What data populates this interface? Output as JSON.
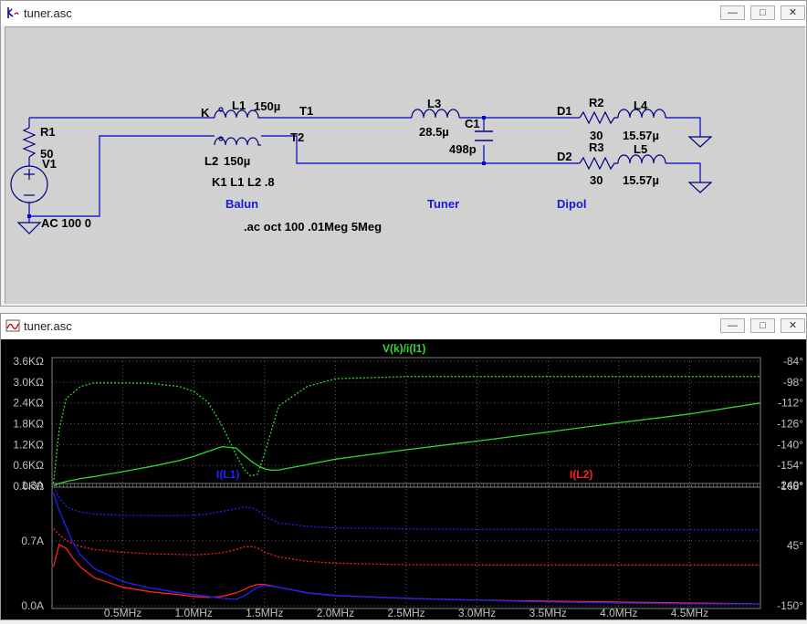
{
  "schematic_window": {
    "title": "tuner.asc",
    "buttons": {
      "minimize": "—",
      "maximize": "□",
      "close": "✕"
    },
    "components": {
      "r1_name": "R1",
      "r1_value": "50",
      "v1_name": "V1",
      "v1_value": "AC 100 0",
      "node_k": "K",
      "l1_name": "L1",
      "l1_value": "150µ",
      "l2_name": "L2",
      "l2_value": "150µ",
      "coupling": "K1 L1 L2 .8",
      "node_t1": "T1",
      "node_t2": "T2",
      "l3_name": "L3",
      "l3_value": "28.5µ",
      "c1_name": "C1",
      "c1_value": "498p",
      "node_d1": "D1",
      "node_d2": "D2",
      "r2_name": "R2",
      "r2_value": "30",
      "r3_name": "R3",
      "r3_value": "30",
      "l4_name": "L4",
      "l4_value": "15.57µ",
      "l5_name": "L5",
      "l5_value": "15.57µ"
    },
    "labels": {
      "balun": "Balun",
      "tuner": "Tuner",
      "dipol": "Dipol"
    },
    "directive": ".ac oct 100 .01Meg 5Meg",
    "colors": {
      "wire": "#0000c8",
      "component": "#000080",
      "label_blue": "#1a1ad0",
      "background": "#d1d1d1"
    }
  },
  "plot_window": {
    "title": "tuner.asc",
    "buttons": {
      "minimize": "—",
      "maximize": "□",
      "close": "✕"
    }
  },
  "chart_data": [
    {
      "type": "line",
      "trace_label": "V(k)/i(l1)",
      "trace_color": "#2ed82e",
      "y_left_ticks": [
        "3.6KΩ",
        "3.0KΩ",
        "2.4KΩ",
        "1.8KΩ",
        "1.2KΩ",
        "0.6KΩ",
        "0.0KΩ"
      ],
      "y_right_ticks": [
        "-84°",
        "-98°",
        "-112°",
        "-126°",
        "-140°",
        "-154°",
        "-168°"
      ],
      "x": [
        0.01,
        0.05,
        0.1,
        0.2,
        0.3,
        0.5,
        0.7,
        0.9,
        1.0,
        1.1,
        1.2,
        1.3,
        1.35,
        1.4,
        1.45,
        1.5,
        1.55,
        1.6,
        1.8,
        2.0,
        2.5,
        3.0,
        3.5,
        4.0,
        4.5,
        5.0
      ],
      "series": [
        {
          "name": "magnitude",
          "values": [
            0.02,
            0.08,
            0.14,
            0.22,
            0.28,
            0.42,
            0.57,
            0.74,
            0.86,
            1.0,
            1.14,
            1.1,
            0.91,
            0.74,
            0.6,
            0.5,
            0.46,
            0.47,
            0.62,
            0.78,
            1.05,
            1.3,
            1.56,
            1.83,
            2.08,
            2.4
          ]
        },
        {
          "name": "phase",
          "values": [
            -166,
            -130,
            -109,
            -101,
            -98.6,
            -98.6,
            -98.9,
            -101,
            -104.3,
            -111.4,
            -127.1,
            -147.1,
            -156,
            -161,
            -160,
            -146,
            -130,
            -114,
            -101,
            -95.7,
            -94.3,
            -94.3,
            -94.3,
            -94.3,
            -94.3,
            -94.3
          ]
        }
      ],
      "ylim": [
        0,
        3.6
      ],
      "y2lim": [
        -168,
        -84
      ],
      "xlim": [
        0,
        5
      ]
    },
    {
      "type": "line",
      "trace_labels": [
        "I(L1)",
        "I(L2)"
      ],
      "trace_colors": [
        "#2020ff",
        "#ff2020"
      ],
      "y_left_ticks": [
        "1.3A",
        "0.7A",
        "0.0A"
      ],
      "y_right_ticks": [
        "240°",
        "45°",
        "-150°"
      ],
      "x_ticks": [
        "0.5MHz",
        "1.0MHz",
        "1.5MHz",
        "2.0MHz",
        "2.5MHz",
        "3.0MHz",
        "3.5MHz",
        "4.0MHz",
        "4.5MHz"
      ],
      "x": [
        0.01,
        0.05,
        0.1,
        0.15,
        0.2,
        0.3,
        0.5,
        0.7,
        0.9,
        1.0,
        1.1,
        1.2,
        1.3,
        1.35,
        1.4,
        1.45,
        1.5,
        1.6,
        1.8,
        2.0,
        2.5,
        3.0,
        3.5,
        4.0,
        4.5,
        5.0
      ],
      "series": [
        {
          "name": "I(L1)",
          "values": [
            1.22,
            1.03,
            0.85,
            0.68,
            0.55,
            0.4,
            0.26,
            0.19,
            0.14,
            0.12,
            0.1,
            0.08,
            0.07,
            0.1,
            0.15,
            0.2,
            0.22,
            0.2,
            0.14,
            0.11,
            0.08,
            0.06,
            0.04,
            0.03,
            0.02,
            0.02
          ]
        },
        {
          "name": "I(L2)",
          "values": [
            0.42,
            0.66,
            0.62,
            0.51,
            0.42,
            0.3,
            0.2,
            0.15,
            0.12,
            0.1,
            0.09,
            0.1,
            0.14,
            0.17,
            0.21,
            0.23,
            0.23,
            0.2,
            0.14,
            0.11,
            0.08,
            0.06,
            0.05,
            0.04,
            0.03,
            0.02
          ]
        },
        {
          "name": "I(L1) phase",
          "values": [
            235,
            200,
            172,
            160,
            154,
            147,
            143,
            142,
            142,
            143,
            147,
            156,
            164,
            170,
            168,
            160,
            140,
            118,
            107,
            102,
            99,
            97,
            97,
            96,
            96,
            96
          ]
        },
        {
          "name": "I(L2) phase",
          "values": [
            100,
            80,
            62,
            50,
            42,
            32,
            23,
            18,
            16,
            15,
            17,
            22,
            32,
            40,
            42,
            38,
            23,
            8,
            -6,
            -12,
            -17,
            -18,
            -18,
            -18,
            -18,
            -18
          ]
        }
      ],
      "ylim": [
        0,
        1.3
      ],
      "y2lim": [
        -150,
        240
      ],
      "xlim": [
        0,
        5
      ]
    }
  ]
}
